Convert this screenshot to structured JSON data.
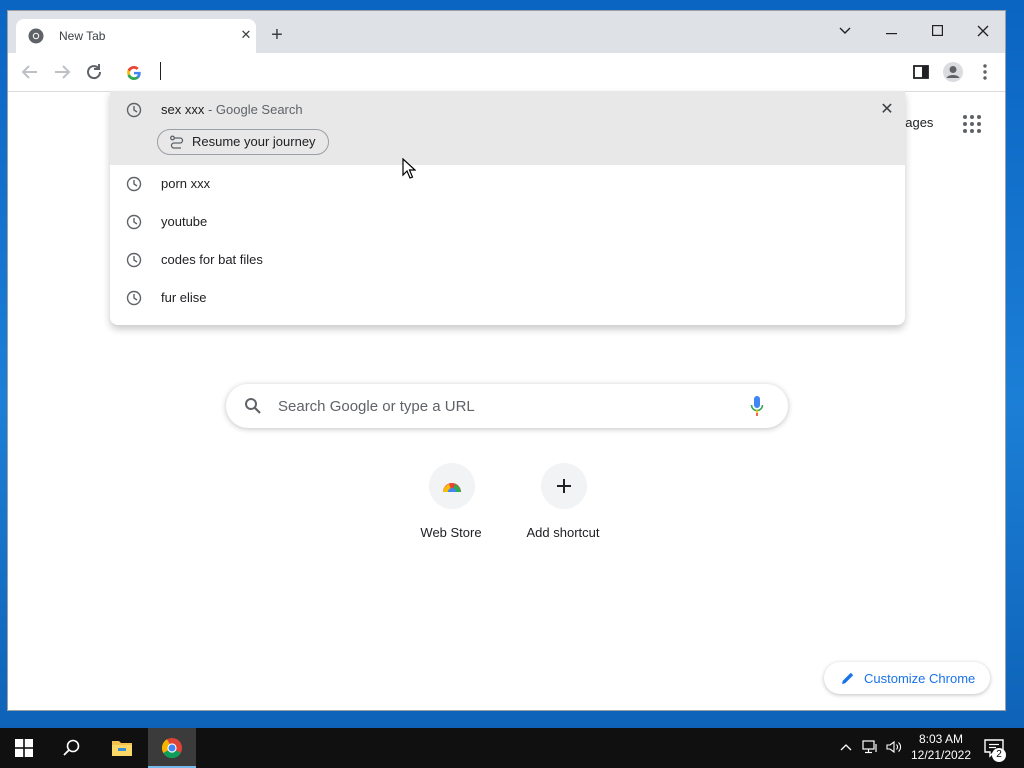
{
  "browser": {
    "tab_title": "New Tab",
    "omnibox_value": ""
  },
  "dropdown": {
    "suggestions": [
      {
        "text": "sex xxx",
        "sub": " - Google Search",
        "selected": true
      },
      {
        "text": "porn xxx",
        "sub": ""
      },
      {
        "text": "youtube",
        "sub": ""
      },
      {
        "text": "codes for bat files",
        "sub": ""
      },
      {
        "text": "fur elise",
        "sub": ""
      }
    ],
    "journey_label": "Resume your journey"
  },
  "ntp": {
    "images_link": "nages",
    "search_placeholder": "Search Google or type a URL",
    "shortcuts": [
      {
        "label": "Web Store"
      },
      {
        "label": "Add shortcut"
      }
    ],
    "customize_label": "Customize Chrome"
  },
  "taskbar": {
    "time": "8:03 AM",
    "date": "12/21/2022",
    "notification_count": "2"
  },
  "colors": {
    "accent": "#1a73e8",
    "desktop": "#1c7fd6",
    "taskbar": "#101010"
  }
}
